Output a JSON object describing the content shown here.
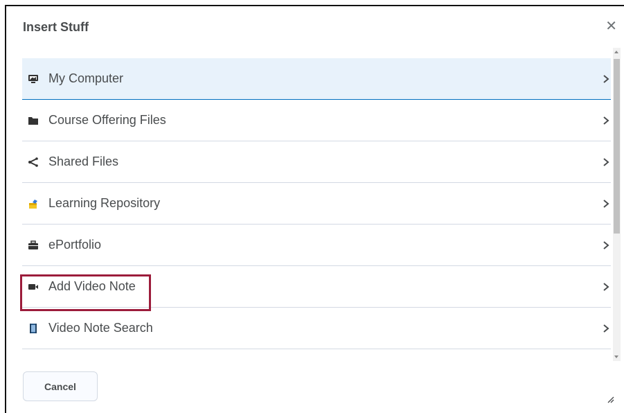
{
  "dialog": {
    "title": "Insert Stuff",
    "close_icon": "close-icon",
    "cancel_label": "Cancel"
  },
  "items": [
    {
      "label": "My Computer",
      "icon": "monitor-icon",
      "selected": true
    },
    {
      "label": "Course Offering Files",
      "icon": "folder-icon"
    },
    {
      "label": "Shared Files",
      "icon": "share-icon"
    },
    {
      "label": "Learning Repository",
      "icon": "learning-repository-icon"
    },
    {
      "label": "ePortfolio",
      "icon": "briefcase-icon"
    },
    {
      "label": "Add Video Note",
      "icon": "video-camera-icon",
      "highlighted": true
    },
    {
      "label": "Video Note Search",
      "icon": "video-search-icon"
    }
  ],
  "colors": {
    "selected_bg": "#e8f2fb",
    "highlight_border": "#9c1c3b",
    "text": "#494c4e"
  }
}
